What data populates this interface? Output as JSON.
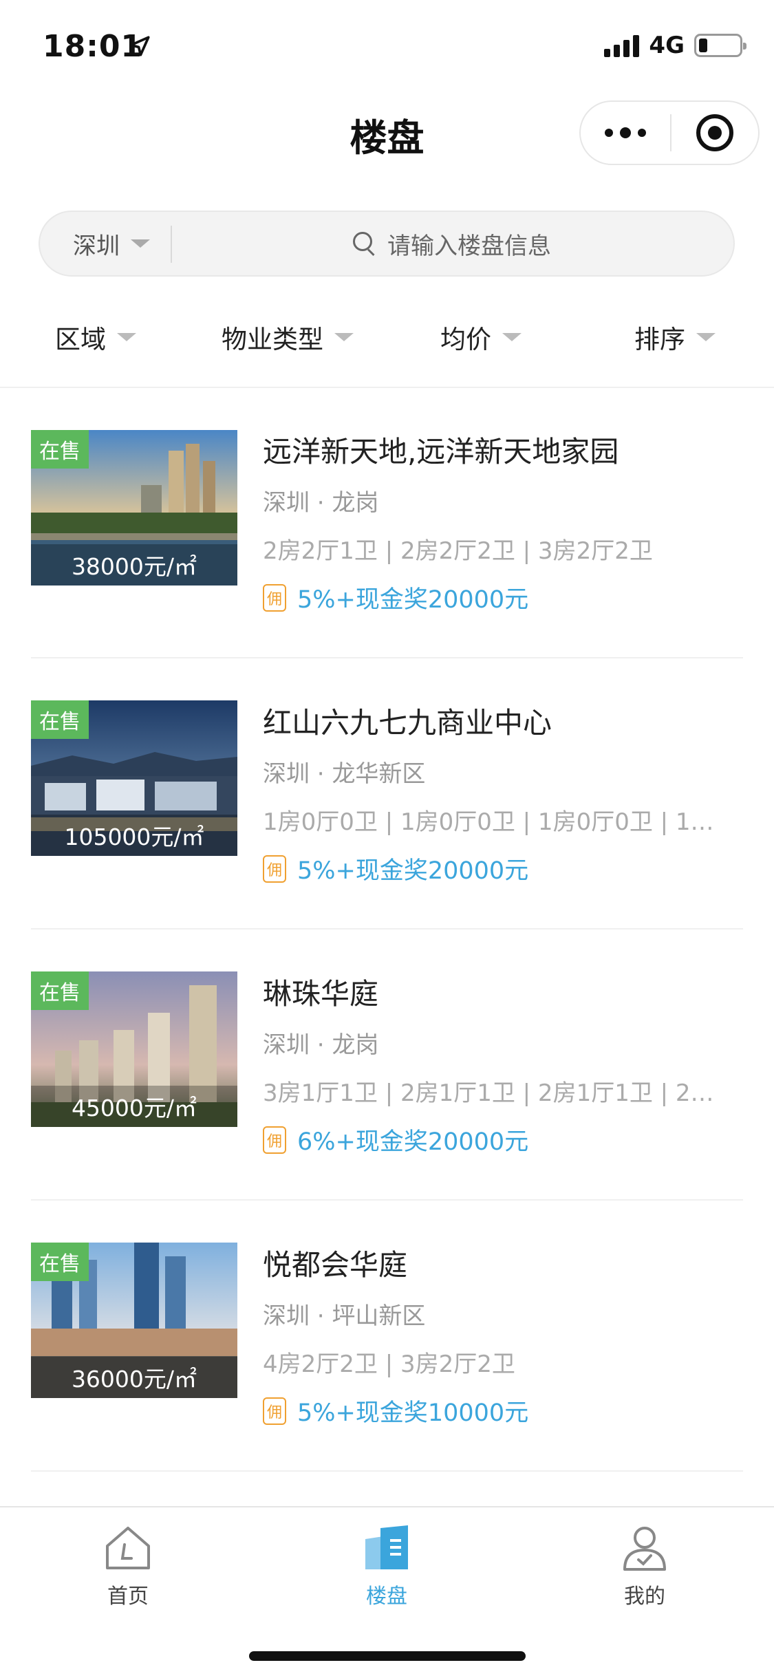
{
  "status_bar": {
    "time": "18:01",
    "network": "4G"
  },
  "nav": {
    "title": "楼盘"
  },
  "search": {
    "city": "深圳",
    "placeholder": "请输入楼盘信息"
  },
  "filters": [
    "区域",
    "物业类型",
    "均价",
    "排序"
  ],
  "listings": [
    {
      "status": "在售",
      "price": "38000元/㎡",
      "title": "远洋新天地,远洋新天地家园",
      "city": "深圳",
      "district": "龙岗",
      "layouts": "2房2厅1卫 | 2房2厅2卫 | 3房2厅2卫",
      "commission_tag": "佣",
      "commission": "5%+现金奖20000元"
    },
    {
      "status": "在售",
      "price": "105000元/㎡",
      "title": "红山六九七九商业中心",
      "city": "深圳",
      "district": "龙华新区",
      "layouts": "1房0厅0卫 | 1房0厅0卫 | 1房0厅0卫 | 1房...",
      "commission_tag": "佣",
      "commission": "5%+现金奖20000元"
    },
    {
      "status": "在售",
      "price": "45000元/㎡",
      "title": "琳珠华庭",
      "city": "深圳",
      "district": "龙岗",
      "layouts": "3房1厅1卫 | 2房1厅1卫 | 2房1厅1卫 | 2房1...",
      "commission_tag": "佣",
      "commission": "6%+现金奖20000元"
    },
    {
      "status": "在售",
      "price": "36000元/㎡",
      "title": "悦都会华庭",
      "city": "深圳",
      "district": "坪山新区",
      "layouts": "4房2厅2卫 | 3房2厅2卫",
      "commission_tag": "佣",
      "commission": "5%+现金奖10000元"
    }
  ],
  "tabbar": [
    {
      "label": "首页",
      "icon": "home-icon",
      "active": false
    },
    {
      "label": "楼盘",
      "icon": "building-icon",
      "active": true
    },
    {
      "label": "我的",
      "icon": "profile-icon",
      "active": false
    }
  ],
  "colors": {
    "accent": "#3ba5dc",
    "on_sale": "#5cb85c",
    "commission_tag": "#f0a030"
  }
}
